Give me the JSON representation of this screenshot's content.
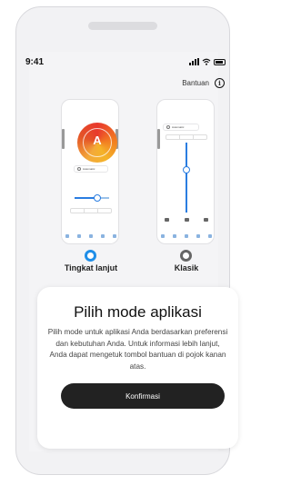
{
  "status": {
    "time": "9:41"
  },
  "help": {
    "label": "Bantuan",
    "icon": "info-icon"
  },
  "mini_auto": {
    "label": "Automatic"
  },
  "mini_classic": {
    "label": "Automatic"
  },
  "options": {
    "advanced": {
      "label": "Tingkat lanjut",
      "selected": true
    },
    "classic": {
      "label": "Klasik",
      "selected": false
    }
  },
  "card": {
    "title": "Pilih mode aplikasi",
    "description": "Pilih mode untuk aplikasi Anda berdasarkan preferensi dan kebutuhan Anda. Untuk informasi lebih lanjut, Anda dapat mengetuk tombol bantuan di pojok kanan atas.",
    "confirm_label": "Konfirmasi"
  },
  "colors": {
    "accent": "#1f8ee8",
    "button": "#222222",
    "orb_primary": "#e8382d"
  }
}
